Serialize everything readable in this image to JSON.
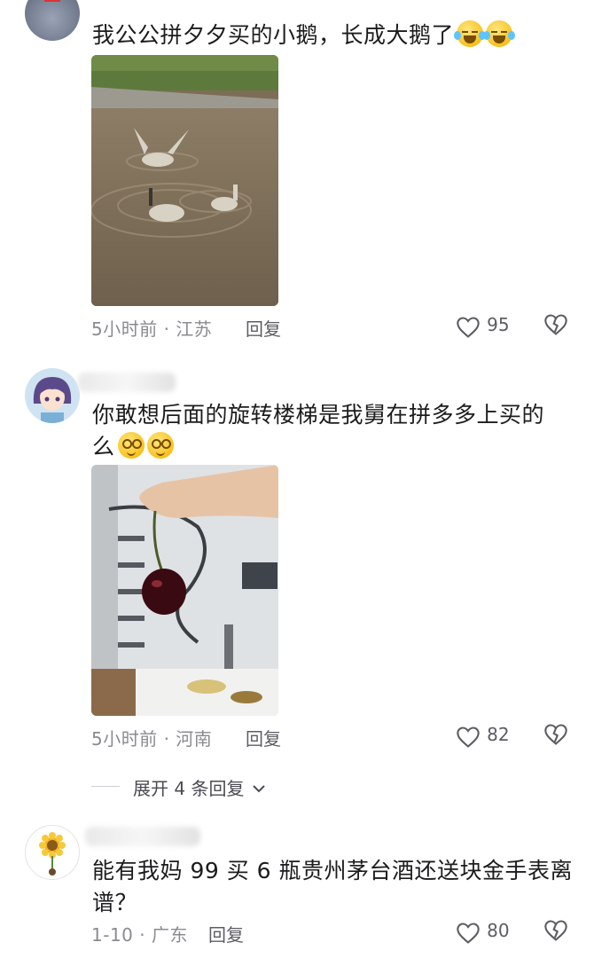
{
  "comments": [
    {
      "text": "我公公拼夕夕买的小鹅，长成大鹅了",
      "meta": "5小时前 · 江苏",
      "reply": "回复",
      "likes": "95"
    },
    {
      "text_line1": "你敢想后面的旋转楼梯是我舅在拼多多上买的",
      "text_line2": "么",
      "meta": "5小时前 · 河南",
      "reply": "回复",
      "likes": "82"
    },
    {
      "text_line1": "能有我妈 99 买 6 瓶贵州茅台酒还送块金手表离",
      "text_line2": "谱？",
      "meta": "1-10 · 广东",
      "reply": "回复",
      "likes": "80"
    }
  ],
  "expand_replies": "展开 4 条回复",
  "colors": {
    "text": "#1c1c1e",
    "meta": "#8a8b91",
    "reply": "#5c5d63"
  },
  "icons": [
    "heart-icon",
    "dislike-icon",
    "chevron-down-icon",
    "laughing-emoji",
    "blush-emoji"
  ]
}
